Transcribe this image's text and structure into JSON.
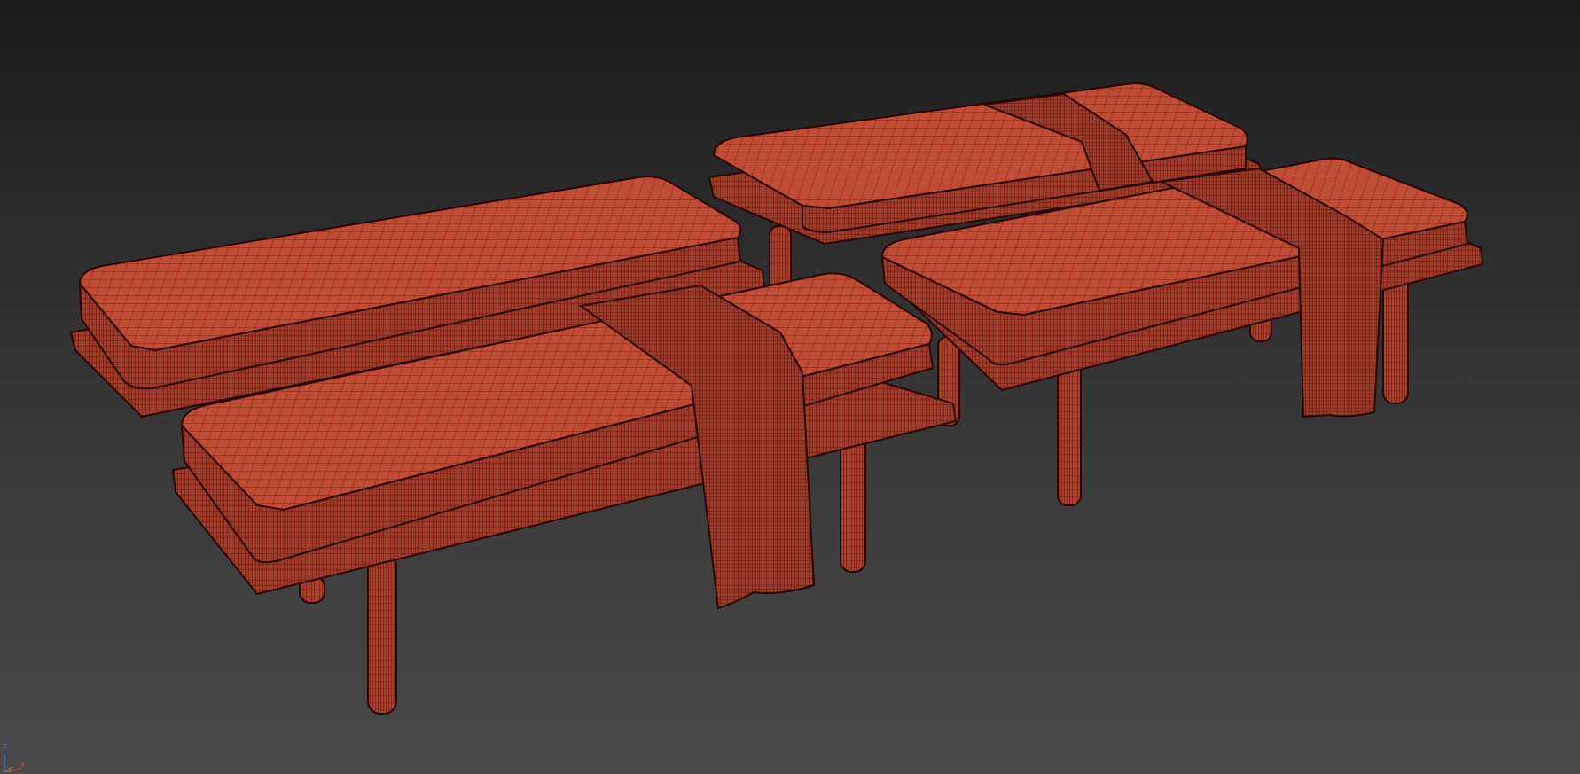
{
  "viewport": {
    "background_top": "#1c1c1c",
    "background_bottom": "#4a4a4a",
    "wireframe_color": "#3a0a05",
    "model_fill_color": "#b0402e"
  },
  "scene": {
    "objects": [
      "bench-back-left",
      "bench-back-right",
      "bench-front-left",
      "bench-front-right"
    ]
  },
  "axis_gizmo": {
    "z_label": "z",
    "x_label": "x",
    "z_color": "#4f6fd0",
    "x_color": "#d04a3a"
  }
}
